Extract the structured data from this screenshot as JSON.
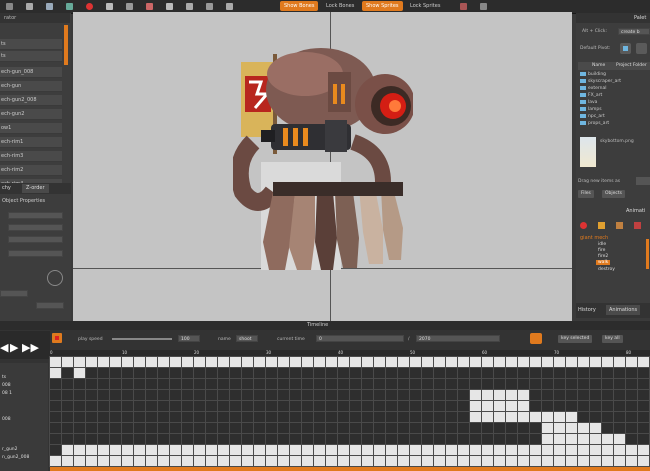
{
  "toolbar": {
    "show_bones": "Show Bones",
    "lock_bones": "Lock Bones",
    "show_sprites": "Show Sprites",
    "lock_sprites": "Lock Sprites"
  },
  "left_panel": {
    "title": "rator",
    "items": [
      "ts",
      "ts",
      "ech-gun_008",
      "ech-gun",
      "ech-gun2_008",
      "ech-gun2",
      "ow1",
      "ech-rim1",
      "ech-rim3",
      "ech-rim2",
      "ech-rim4"
    ],
    "tabs": [
      "chy",
      "Z-order"
    ],
    "props_title": "Object Properties",
    "prop_rows": [
      "",
      "",
      "",
      "",
      "",
      ""
    ]
  },
  "right_panel": {
    "title": "Palet",
    "alt_click": "Alt + Click:",
    "alt_value": "create b",
    "default_pivot": "Default Pivot:",
    "headers": [
      "Name",
      "Project Folder"
    ],
    "tree": [
      "building",
      "skyscraper_art",
      "external",
      "FX_art",
      "lava",
      "lamps",
      "npc_art",
      "props_art"
    ],
    "file_label": "skybottom.png",
    "drag_label": "Drag new items as",
    "tabs": [
      "Files",
      "Objects"
    ],
    "anim_title": "Animati",
    "anim_tree": [
      "giant mech",
      "idle",
      "fire",
      "fire2",
      "walk",
      "destroy"
    ],
    "anim_selected": "walk",
    "bottom_tabs": [
      "History",
      "Animations"
    ]
  },
  "timeline": {
    "title": "Timeline",
    "play_speed_label": "play speed",
    "play_speed_value": "100",
    "name_label": "name",
    "name_value": "shoot",
    "current_time_label": "current time",
    "current_time_value": "0",
    "slash": "/",
    "total_time": "2070",
    "key_selected": "key selected",
    "key_all": "key all",
    "ruler": [
      "0",
      "10",
      "20",
      "30",
      "40",
      "50",
      "60",
      "70",
      "80"
    ],
    "tracks": [
      "",
      "ts",
      "008",
      "08 1",
      "",
      "008",
      "",
      "",
      "",
      "r_gun2",
      "n_gun2_008"
    ]
  },
  "colors": {
    "accent": "#e07a1e",
    "canvas": "#c4c4c4",
    "folder": "#6fb6e0"
  }
}
